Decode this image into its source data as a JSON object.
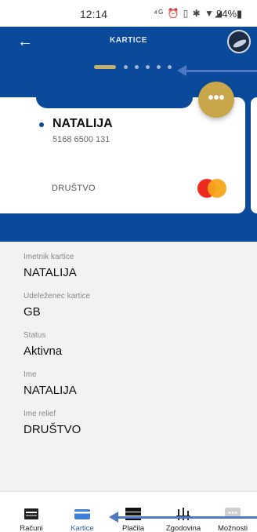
{
  "status_bar": {
    "time": "12:14",
    "icons": "⁴ᴳ ⏰ ▯ ✱ ▼◢",
    "battery": "94%▮"
  },
  "header": {
    "title": "KARTICE",
    "back_icon": "arrow-left-icon"
  },
  "card": {
    "holder_name": "NATALIJA",
    "number": "5168 6500 131",
    "relief": "DRUŠTVO",
    "more_label": "•••",
    "brand": "mastercard"
  },
  "details": [
    {
      "label": "Imetnik kartice",
      "value": "NATALIJA"
    },
    {
      "label": "Udeleženec kartice",
      "value": "GB"
    },
    {
      "label": "Status",
      "value": "Aktivna"
    },
    {
      "label": "Ime",
      "value": "NATALIJA"
    },
    {
      "label": "Ime relief",
      "value": "DRUŠTVO"
    }
  ],
  "nav": [
    {
      "label": "Računi",
      "icon": "accounts-icon"
    },
    {
      "label": "Kartice",
      "icon": "card-icon",
      "active": true
    },
    {
      "label": "Plačila",
      "icon": "payments-icon"
    },
    {
      "label": "Zgodovina",
      "icon": "history-icon"
    },
    {
      "label": "Možnosti",
      "icon": "options-icon"
    }
  ],
  "colors": {
    "brand_blue": "#0b4a9a",
    "gold": "#c8a64a",
    "annotation_arrow": "#4d78c4"
  }
}
